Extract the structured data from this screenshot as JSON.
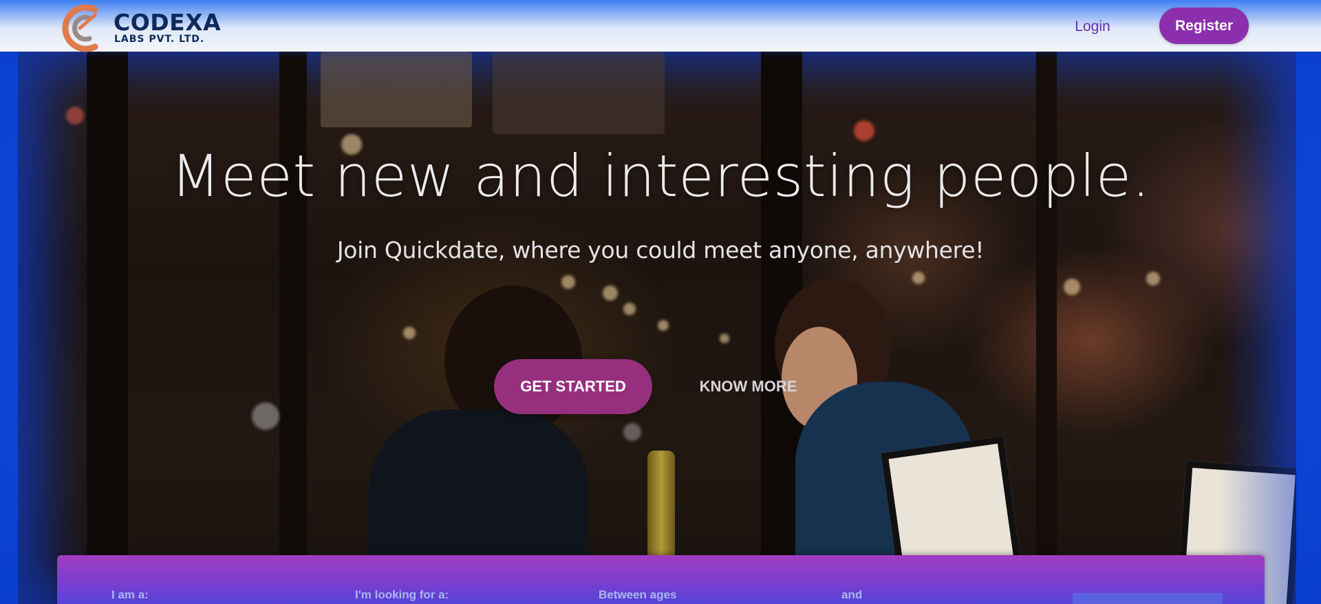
{
  "header": {
    "brand_name": "CODEXA",
    "brand_sub": "LABS PVT. LTD.",
    "login_label": "Login",
    "register_label": "Register"
  },
  "hero": {
    "title": "Meet new and interesting people.",
    "subtitle": "Join Quickdate, where you could meet anyone, anywhere!",
    "get_started_label": "GET STARTED",
    "know_more_label": "KNOW MORE"
  },
  "search": {
    "i_am_label": "I am a:",
    "looking_for_label": "I'm looking for a:",
    "between_ages_label": "Between ages",
    "and_label": "and"
  },
  "colors": {
    "accent_purple": "#8b2fae",
    "cta_magenta": "#96307e",
    "brand_navy": "#0e2a5a",
    "logo_orange": "#e07a4a"
  }
}
